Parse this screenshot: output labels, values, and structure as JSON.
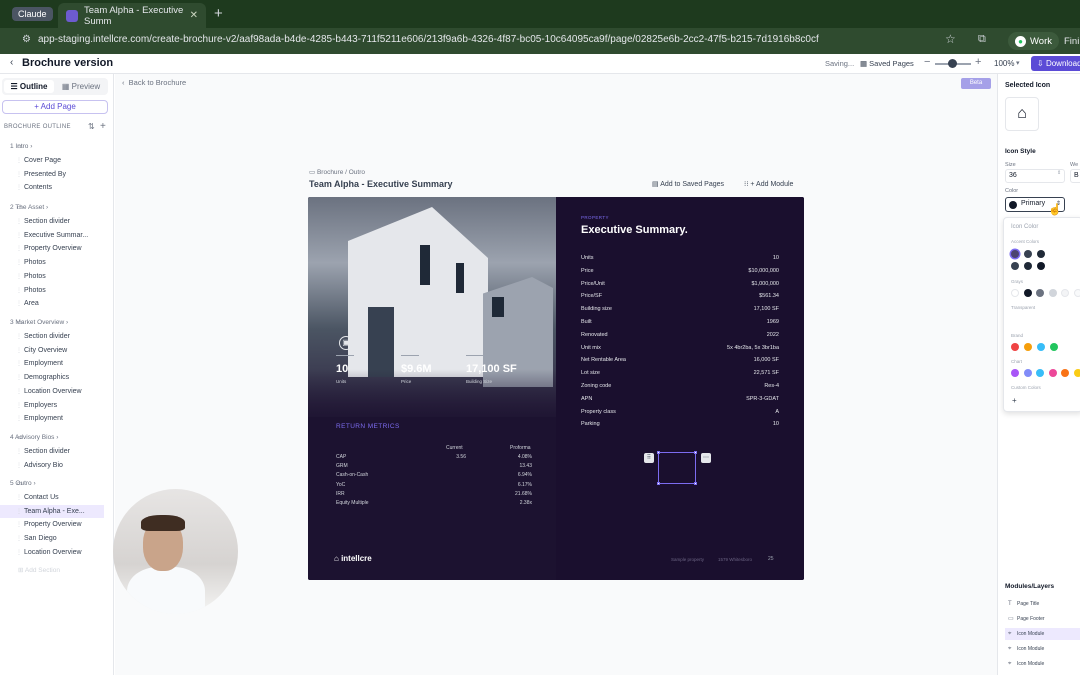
{
  "browser": {
    "tab_claude": "Claude",
    "tab_active": "Team Alpha - Executive Summ",
    "url": "app-staging.intellcre.com/create-brochure-v2/aaf98ada-b4de-4285-b443-711f5211e606/213f9a6b-4326-4f87-bc05-10c64095ca9f/page/02825e6b-2cc2-47f5-b215-7d1916b8c0cf",
    "work_label": "Work",
    "finish_label": "Fini"
  },
  "header": {
    "title": "Brochure version",
    "saving": "Saving...",
    "saved_pages": "Saved Pages",
    "zoom": "100%",
    "download": "Download"
  },
  "sidebar": {
    "tab_outline": "Outline",
    "tab_preview": "Preview",
    "add_page": "+ Add Page",
    "outline_heading": "BROCHURE OUTLINE",
    "sections": [
      {
        "label": "1  Intro",
        "items": [
          "Cover Page",
          "Presented By",
          "Contents"
        ]
      },
      {
        "label": "2  The Asset",
        "items": [
          "Section divider",
          "Executive Summar...",
          "Property Overview",
          "Photos",
          "Photos",
          "Photos",
          "Area"
        ]
      },
      {
        "label": "3  Market Overview",
        "items": [
          "Section divider",
          "City Overview",
          "Employment",
          "Demographics",
          "Location Overview",
          "Employers",
          "Employment"
        ]
      },
      {
        "label": "4  Advisory Bios",
        "items": [
          "Section divider",
          "Advisory Bio"
        ]
      },
      {
        "label": "5  Outro",
        "items": [
          "Contact Us",
          "Team Alpha - Exe...",
          "Property Overview",
          "San Diego",
          "Location Overview"
        ]
      }
    ],
    "add_section": "Add Section"
  },
  "canvas": {
    "back": "Back to Brochure",
    "beta": "Beta",
    "crumb": "Brochure  /  Outro",
    "page_name": "Team Alpha - Executive Summary",
    "add_saved": "Add to Saved Pages",
    "add_module": "+ Add Module"
  },
  "slide": {
    "stats": [
      {
        "value": "10",
        "label": "Units"
      },
      {
        "value": "$9.6M",
        "label": "Price"
      },
      {
        "value": "17,100 SF",
        "label": "Building Size"
      }
    ],
    "return_metrics_title": "RETURN METRICS",
    "rm_headers": [
      "Current",
      "Proforma"
    ],
    "rm_rows": [
      {
        "k": "CAP",
        "c": "3.56",
        "p": "4.08%"
      },
      {
        "k": "GRM",
        "c": "",
        "p": "13.43"
      },
      {
        "k": "Cash-on-Cash",
        "c": "",
        "p": "6.94%"
      },
      {
        "k": "YoC",
        "c": "",
        "p": "6.17%"
      },
      {
        "k": "IRR",
        "c": "",
        "p": "21.68%"
      },
      {
        "k": "Equity Multiple",
        "c": "",
        "p": "2.38x"
      }
    ],
    "logo": "intellcre",
    "eyebrow": "PROPERTY",
    "title": "Executive Summary.",
    "details": [
      {
        "k": "Units",
        "v": "10"
      },
      {
        "k": "Price",
        "v": "$10,000,000"
      },
      {
        "k": "Price/Unit",
        "v": "$1,000,000"
      },
      {
        "k": "Price/SF",
        "v": "$561.34"
      },
      {
        "k": "Building size",
        "v": "17,100 SF"
      },
      {
        "k": "Built",
        "v": "1969"
      },
      {
        "k": "Renovated",
        "v": "2022"
      },
      {
        "k": "Unit mix",
        "v": "5x 4br2ba, 5x 3br1ba"
      },
      {
        "k": "Net Rentable Area",
        "v": "16,000 SF"
      },
      {
        "k": "Lot size",
        "v": "22,571 SF"
      },
      {
        "k": "Zoning code",
        "v": "Res-4"
      },
      {
        "k": "APN",
        "v": "SPR-3-GDAT"
      },
      {
        "k": "Property class",
        "v": "A"
      },
      {
        "k": "Parking",
        "v": "10"
      }
    ],
    "footer_a": "Sample property",
    "footer_b": "1579 Whitesboro",
    "footer_c": "25"
  },
  "rpanel": {
    "selected_icon": "Selected Icon",
    "icon_style": "Icon Style",
    "size_label": "Size",
    "size_value": "36",
    "we_label": "We",
    "we_value": "B",
    "color_label": "Color",
    "color_value": "Primary",
    "popover_title": "Icon Color",
    "accent_label": "Accent Colors",
    "grays_label": "Grays",
    "transparent_label": "Transparent",
    "brand_label": "Brand",
    "chart_label": "Chart",
    "custom_label": "Custom Colors",
    "layers_title": "Modules/Layers",
    "layers": [
      "Page Title",
      "Page Footer",
      "Icon Module",
      "Icon Module",
      "Icon Module"
    ]
  },
  "colors": {
    "accent": "#5b4bd6",
    "slide_bg": "#1c1230",
    "accent_swatches": [
      "#4c4470",
      "#374151",
      "#1f2937",
      "#374151",
      "#1f2937",
      "#111827"
    ],
    "gray_swatches": [
      "#ffffff",
      "#111827",
      "#6b7280",
      "#d1d5db",
      "#f3f4f6",
      "#f9fafb"
    ],
    "brand_swatches": [
      "#ef4444",
      "#f59e0b",
      "#38bdf8",
      "#22c55e"
    ],
    "chart_swatches": [
      "#a855f7",
      "#818cf8",
      "#38bdf8",
      "#ec4899",
      "#f97316",
      "#facc15"
    ]
  },
  "icons": [
    "home-icon",
    "dollar-icon",
    "building-icon",
    "units-icon"
  ]
}
